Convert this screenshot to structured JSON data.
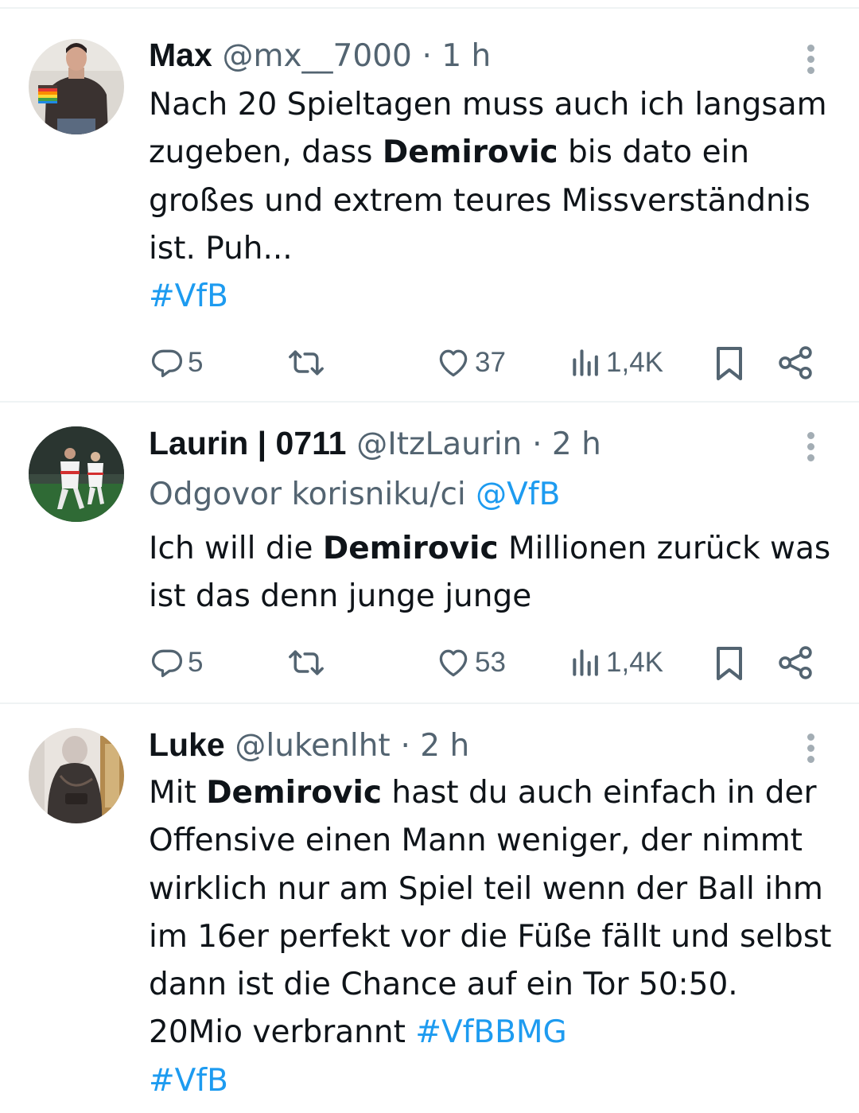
{
  "tweets": [
    {
      "name": "Max",
      "handle": "@mx__7000",
      "time": "· 1 h",
      "body_segments": [
        {
          "text": "Nach 20 Spieltagen muss auch ich langsam zugeben, dass "
        },
        {
          "text": "Demirovic",
          "bold": true
        },
        {
          "text": " bis dato ein großes und extrem teures Missverständnis ist. Puh..."
        },
        {
          "br": true
        },
        {
          "text": "#VfB",
          "link": true
        }
      ],
      "replies": "5",
      "likes": "37",
      "views": "1,4K"
    },
    {
      "name": "Laurin | 0711",
      "handle": "@ItzLaurin",
      "time": "· 2 h",
      "reply_to_label": "Odgovor korisniku/ci",
      "reply_to_handle": "@VfB",
      "body_segments": [
        {
          "text": "Ich will die "
        },
        {
          "text": "Demirovic",
          "bold": true
        },
        {
          "text": " Millionen zurück was ist das denn junge junge"
        }
      ],
      "replies": "5",
      "likes": "53",
      "views": "1,4K"
    },
    {
      "name": "Luke",
      "handle": "@lukenlht",
      "time": "· 2 h",
      "body_segments": [
        {
          "text": "Mit "
        },
        {
          "text": "Demirovic",
          "bold": true
        },
        {
          "text": " hast du auch einfach in der Offensive einen Mann weniger, der nimmt wirklich nur am Spiel teil wenn der Ball ihm im 16er perfekt vor die Füße fällt und selbst dann ist die Chance auf ein Tor 50:50. 20Mio verbrannt "
        },
        {
          "text": "#VfBBMG",
          "link": true
        },
        {
          "br": true
        },
        {
          "text": "#VfB",
          "link": true
        }
      ]
    }
  ],
  "icons": {
    "reply": "reply-icon",
    "retweet": "retweet-icon",
    "like": "heart-icon",
    "views": "views-icon",
    "bookmark": "bookmark-icon",
    "share": "share-icon",
    "more": "more-icon"
  },
  "colors": {
    "link": "#1d9bf0",
    "secondary_text": "#536471",
    "text": "#0f1419",
    "divider": "#eff3f4"
  }
}
